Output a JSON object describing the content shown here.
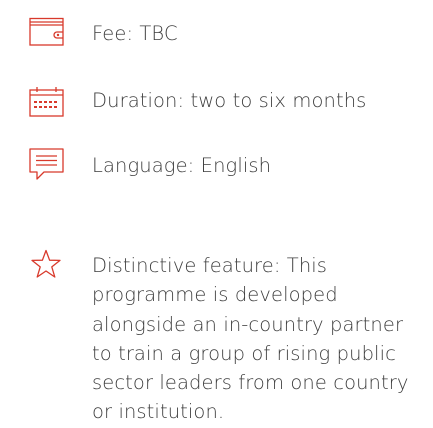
{
  "accent_color": "#d8392b",
  "items": [
    {
      "icon": "wallet-icon",
      "text": "Fee: TBC"
    },
    {
      "icon": "calendar-icon",
      "text": "Duration: two to six months"
    },
    {
      "icon": "speech-bubble-icon",
      "text": "Language: English"
    },
    {
      "icon": "star-icon",
      "text": "Distinctive feature: This programme is developed alongside an in-country partner to train a group of rising public sector leaders from one country or institution."
    }
  ]
}
